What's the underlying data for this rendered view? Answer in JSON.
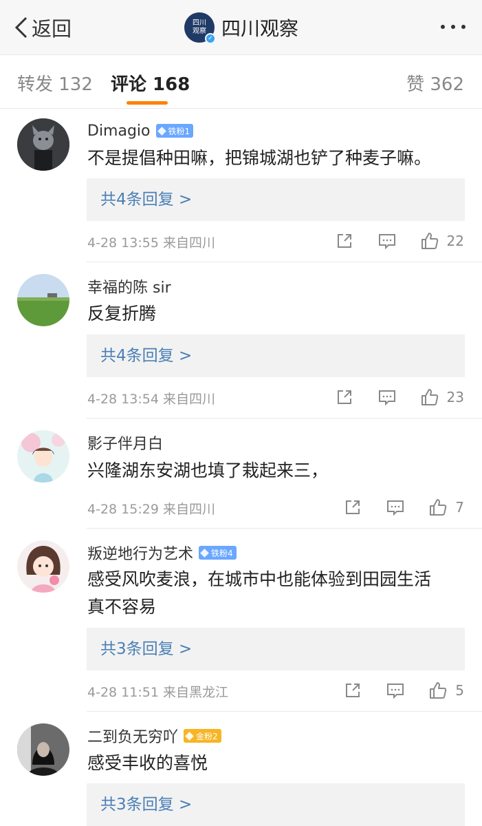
{
  "nav": {
    "back_label": "返回",
    "account_name": "四川观察",
    "logo_line1": "四川",
    "logo_line2": "观察"
  },
  "tabs": {
    "repost": "转发 132",
    "comments": "评论 168",
    "likes": "赞 362"
  },
  "comments": [
    {
      "name": "Dimagio",
      "badge": "铁粉1",
      "text": "不是提倡种田嘛，把锦城湖也铲了种麦子嘛。",
      "replies": "共4条回复 >",
      "time": "4-28 13:55",
      "source": "来自四川",
      "likes": "22"
    },
    {
      "name": "幸福的陈 sir",
      "badge": "",
      "text": "反复折腾",
      "replies": "共4条回复 >",
      "time": "4-28 13:54",
      "source": "来自四川",
      "likes": "23"
    },
    {
      "name": "影子伴月白",
      "badge": "",
      "text": "兴隆湖东安湖也填了栽起来三，",
      "replies": "",
      "time": "4-28 15:29",
      "source": "来自四川",
      "likes": "7"
    },
    {
      "name": "叛逆地行为艺术",
      "badge": "铁粉4",
      "text_line1": "感受风吹麦浪，在城市中也能体验到田园生活",
      "text_line2": "真不容易",
      "replies": "共3条回复 >",
      "time": "4-28 11:51",
      "source": "来自黑龙江",
      "likes": "5"
    },
    {
      "name": "二到负无穷吖",
      "badge": "金粉2",
      "text": "感受丰收的喜悦",
      "replies": "共3条回复 >"
    }
  ]
}
